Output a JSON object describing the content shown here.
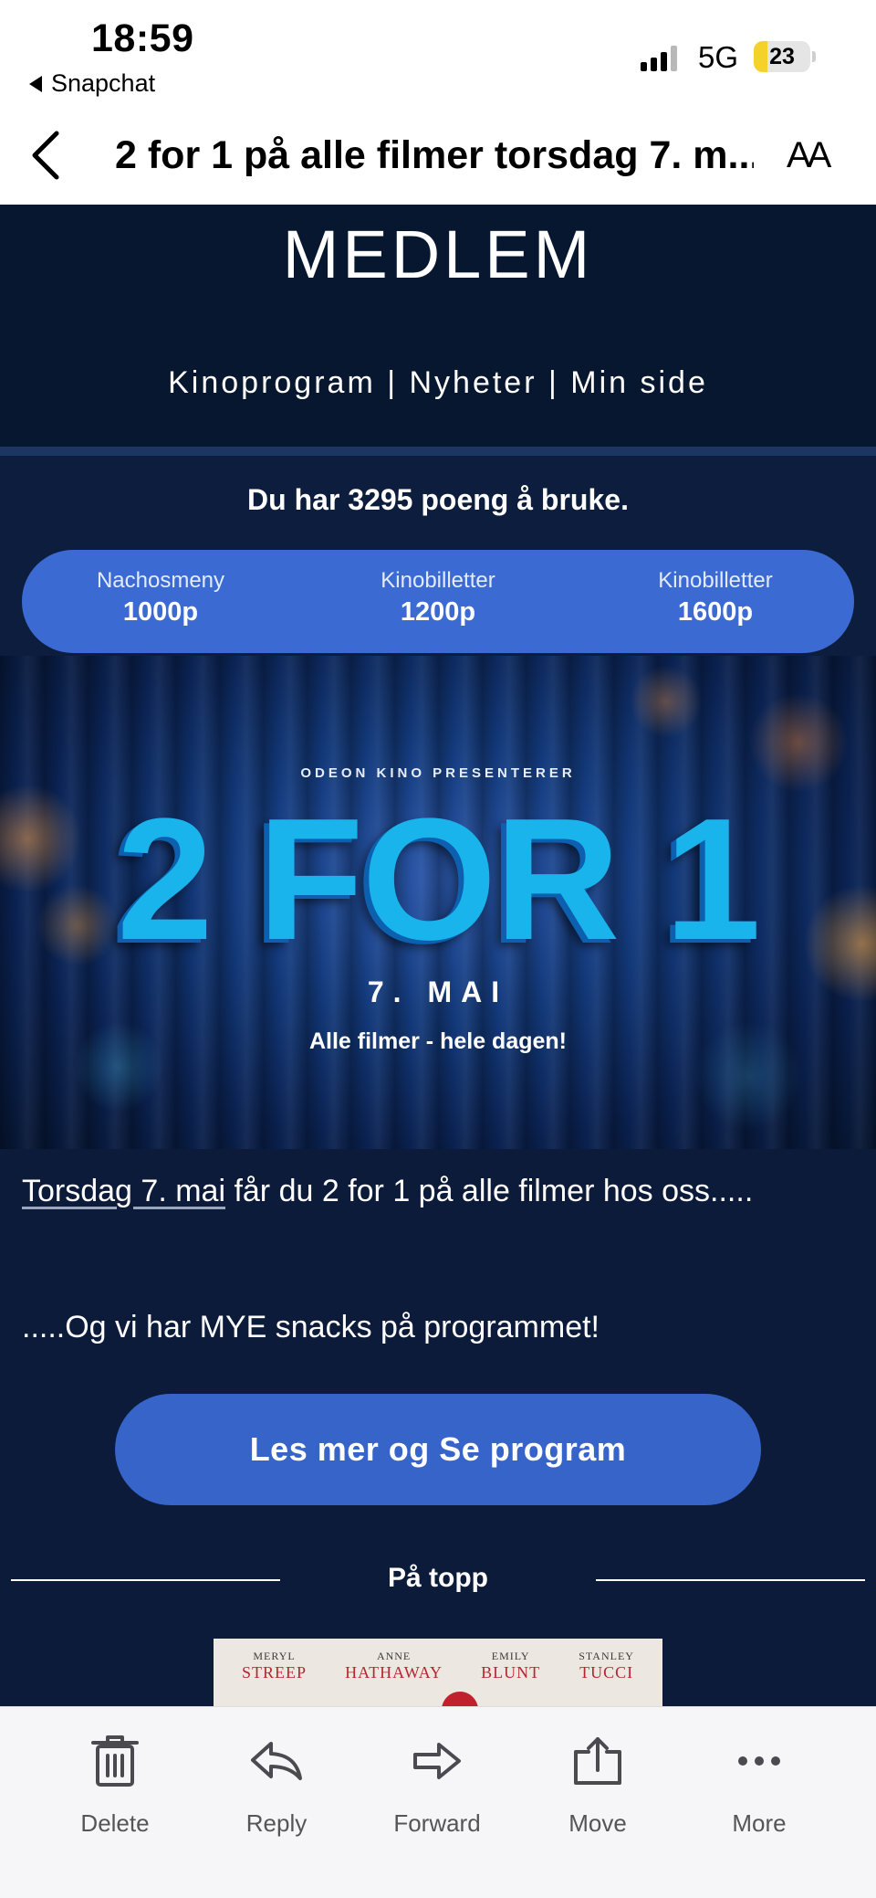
{
  "status_bar": {
    "time": "18:59",
    "back_app": "Snapchat",
    "network": "5G",
    "battery": "23"
  },
  "nav": {
    "title": "2 for 1 på alle filmer torsdag 7. m...",
    "text_size_label": "AA"
  },
  "email": {
    "brand": "MEDLEM",
    "topnav": "Kinoprogram | Nyheter | Min side",
    "points_text": "Du har 3295 poeng å bruke.",
    "rewards": [
      {
        "name": "Nachosmeny",
        "points": "1000p"
      },
      {
        "name": "Kinobilletter",
        "points": "1200p"
      },
      {
        "name": "Kinobilletter",
        "points": "1600p"
      }
    ],
    "banner": {
      "presenter": "ODEON KINO PRESENTERER",
      "headline": "2 FOR 1",
      "date": "7. MAI",
      "subline": "Alle filmer - hele dagen!"
    },
    "body": {
      "link_text": "Torsdag 7. mai",
      "text_rest": " får du 2 for 1 på alle filmer hos oss.....",
      "text2": ".....Og vi har MYE snacks på programmet!"
    },
    "cta_label": "Les mer og Se program",
    "section_title": "På topp",
    "poster_actors": [
      {
        "first": "MERYL",
        "last": "STREEP"
      },
      {
        "first": "ANNE",
        "last": "HATHAWAY"
      },
      {
        "first": "EMILY",
        "last": "BLUNT"
      },
      {
        "first": "STANLEY",
        "last": "TUCCI"
      }
    ]
  },
  "toolbar": {
    "items": [
      {
        "label": "Delete",
        "icon": "trash-icon"
      },
      {
        "label": "Reply",
        "icon": "reply-icon"
      },
      {
        "label": "Forward",
        "icon": "forward-icon"
      },
      {
        "label": "Move",
        "icon": "move-icon"
      },
      {
        "label": "More",
        "icon": "more-icon"
      }
    ]
  },
  "colors": {
    "email_bg": "#0c1b3a",
    "accent_blue": "#3764c8",
    "headline_cyan": "#19b4ec"
  }
}
